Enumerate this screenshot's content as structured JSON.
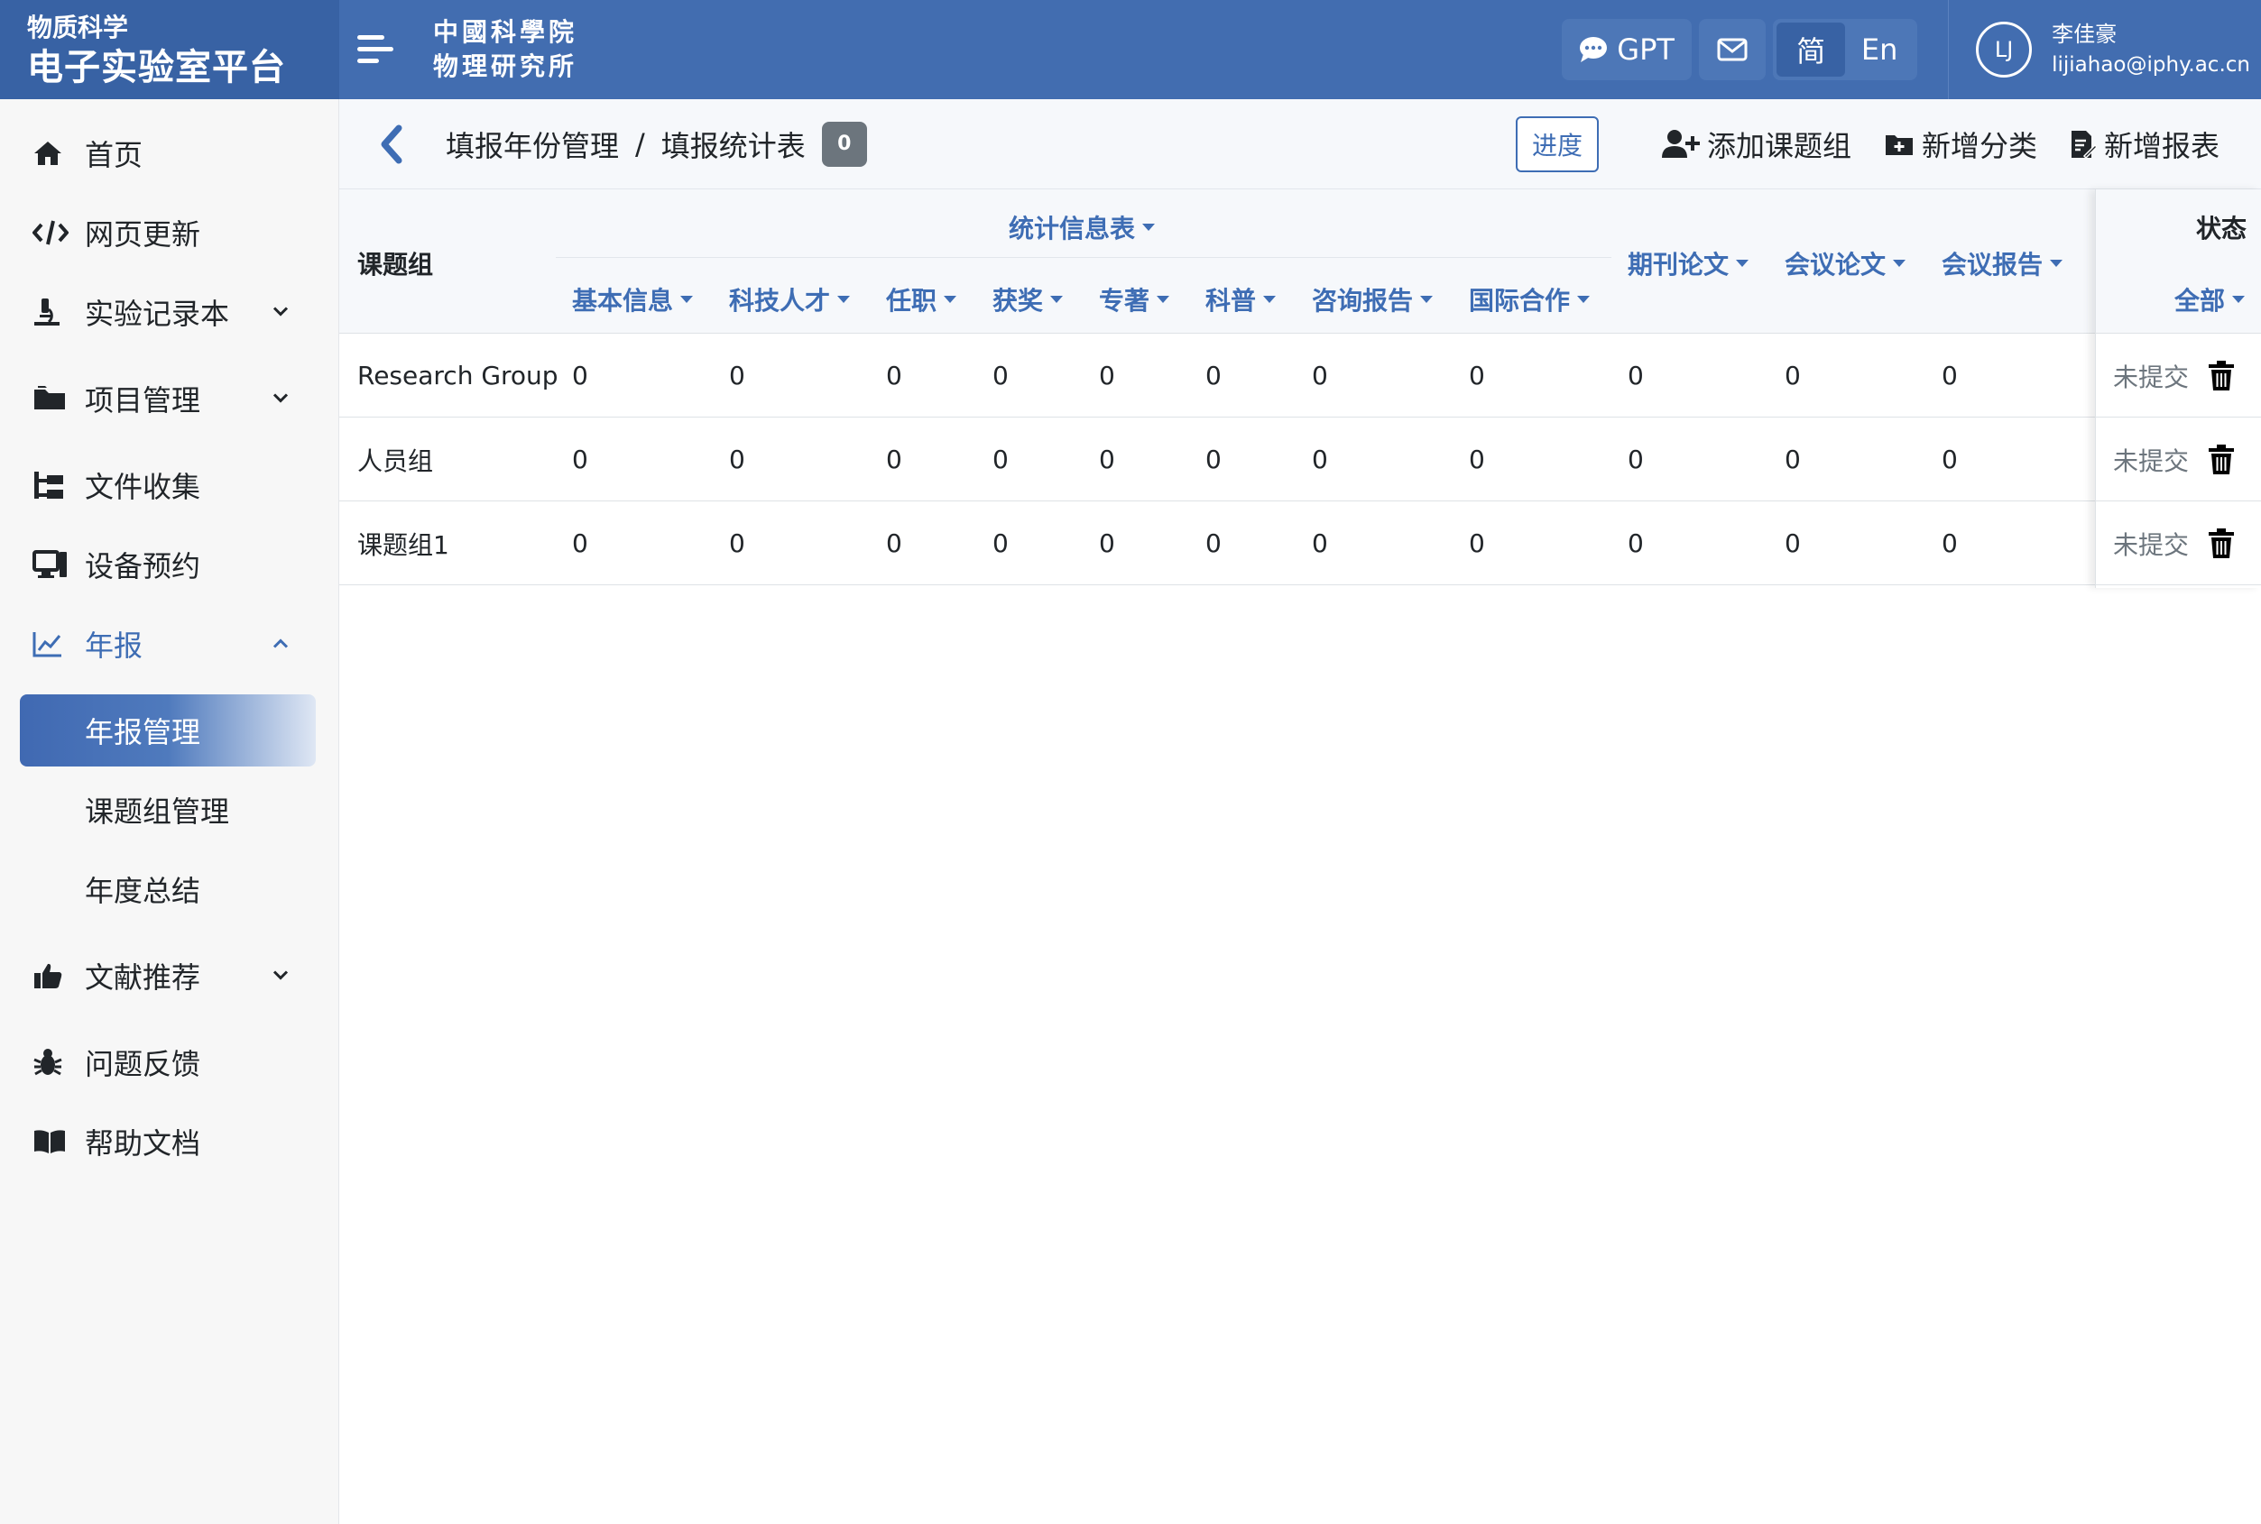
{
  "brand": {
    "subtitle": "物质科学",
    "title": "电子实验室平台"
  },
  "institute_logo": {
    "line1": "中國科學院",
    "line2": "物理研究所"
  },
  "topbar": {
    "gpt_label": "GPT",
    "lang_zh": "简",
    "lang_en": "En",
    "user": {
      "initials": "LJ",
      "name": "李佳豪",
      "email": "lijiahao@iphy.ac.cn"
    }
  },
  "sidebar": {
    "items": [
      {
        "label": "首页",
        "icon": "home-icon"
      },
      {
        "label": "网页更新",
        "icon": "code-icon"
      },
      {
        "label": "实验记录本",
        "icon": "microscope-icon"
      },
      {
        "label": "项目管理",
        "icon": "folder-icon"
      },
      {
        "label": "文件收集",
        "icon": "sitemap-icon"
      },
      {
        "label": "设备预约",
        "icon": "computer-icon"
      },
      {
        "label": "年报",
        "icon": "chart-line-icon"
      },
      {
        "label": "文献推荐",
        "icon": "thumbs-up-icon"
      },
      {
        "label": "问题反馈",
        "icon": "bug-icon"
      },
      {
        "label": "帮助文档",
        "icon": "book-icon"
      }
    ],
    "annual_sub": [
      {
        "label": "年报管理"
      },
      {
        "label": "课题组管理"
      },
      {
        "label": "年度总结"
      }
    ]
  },
  "header": {
    "breadcrumb_parent": "填报年份管理",
    "breadcrumb_sep": "/",
    "breadcrumb_current": "填报统计表",
    "count": "0",
    "progress_label": "进度",
    "add_group_label": "添加课题组",
    "add_category_label": "新增分类",
    "add_report_label": "新增报表"
  },
  "table": {
    "group_col_header": "课题组",
    "stat_group_header": "统计信息表",
    "sub_headers": [
      "基本信息",
      "科技人才",
      "任职",
      "获奖",
      "专著",
      "科普",
      "咨询报告",
      "国际合作"
    ],
    "other_headers": [
      "期刊论文",
      "会议论文",
      "会议报告"
    ],
    "status_header": "状态",
    "status_filter": "全部",
    "rows": [
      {
        "name": "Research Group",
        "values": [
          "0",
          "0",
          "0",
          "0",
          "0",
          "0",
          "0",
          "0",
          "0",
          "0",
          "0"
        ],
        "status": "未提交"
      },
      {
        "name": "人员组",
        "values": [
          "0",
          "0",
          "0",
          "0",
          "0",
          "0",
          "0",
          "0",
          "0",
          "0",
          "0"
        ],
        "status": "未提交"
      },
      {
        "name": "课题组1",
        "values": [
          "0",
          "0",
          "0",
          "0",
          "0",
          "0",
          "0",
          "0",
          "0",
          "0",
          "0"
        ],
        "status": "未提交"
      }
    ]
  },
  "colors": {
    "primary": "#426db0",
    "brand_bg": "#3862a4",
    "link": "#3e6db4",
    "badge": "#6c757d"
  }
}
